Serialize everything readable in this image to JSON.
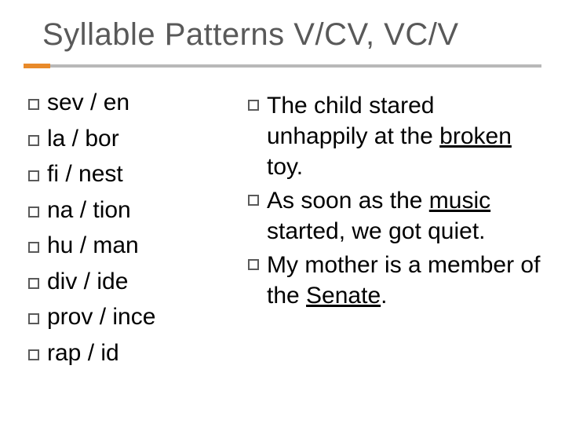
{
  "title": "Syllable Patterns V/CV, VC/V",
  "words": [
    "sev / en",
    "la / bor",
    "fi / nest",
    "na / tion",
    "hu / man",
    "div / ide",
    "prov / ince",
    "rap / id"
  ],
  "sentences": [
    {
      "pre": "The child stared unhappily at the ",
      "underlined": "broken",
      "post": " toy."
    },
    {
      "pre": "As soon as the ",
      "underlined": "music",
      "post": " started, we got quiet."
    },
    {
      "pre": "My mother is a member of the ",
      "underlined": "Senate",
      "post": "."
    }
  ]
}
